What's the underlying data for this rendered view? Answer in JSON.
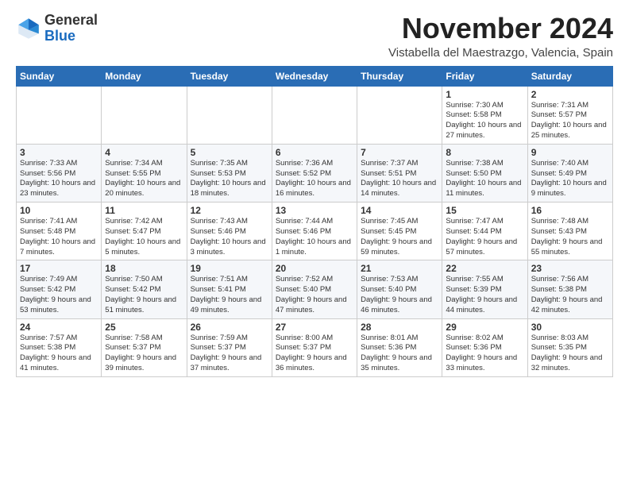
{
  "header": {
    "logo_general": "General",
    "logo_blue": "Blue",
    "month_title": "November 2024",
    "location": "Vistabella del Maestrazgo, Valencia, Spain"
  },
  "weekdays": [
    "Sunday",
    "Monday",
    "Tuesday",
    "Wednesday",
    "Thursday",
    "Friday",
    "Saturday"
  ],
  "weeks": [
    [
      {
        "day": "",
        "info": ""
      },
      {
        "day": "",
        "info": ""
      },
      {
        "day": "",
        "info": ""
      },
      {
        "day": "",
        "info": ""
      },
      {
        "day": "",
        "info": ""
      },
      {
        "day": "1",
        "info": "Sunrise: 7:30 AM\nSunset: 5:58 PM\nDaylight: 10 hours and 27 minutes."
      },
      {
        "day": "2",
        "info": "Sunrise: 7:31 AM\nSunset: 5:57 PM\nDaylight: 10 hours and 25 minutes."
      }
    ],
    [
      {
        "day": "3",
        "info": "Sunrise: 7:33 AM\nSunset: 5:56 PM\nDaylight: 10 hours and 23 minutes."
      },
      {
        "day": "4",
        "info": "Sunrise: 7:34 AM\nSunset: 5:55 PM\nDaylight: 10 hours and 20 minutes."
      },
      {
        "day": "5",
        "info": "Sunrise: 7:35 AM\nSunset: 5:53 PM\nDaylight: 10 hours and 18 minutes."
      },
      {
        "day": "6",
        "info": "Sunrise: 7:36 AM\nSunset: 5:52 PM\nDaylight: 10 hours and 16 minutes."
      },
      {
        "day": "7",
        "info": "Sunrise: 7:37 AM\nSunset: 5:51 PM\nDaylight: 10 hours and 14 minutes."
      },
      {
        "day": "8",
        "info": "Sunrise: 7:38 AM\nSunset: 5:50 PM\nDaylight: 10 hours and 11 minutes."
      },
      {
        "day": "9",
        "info": "Sunrise: 7:40 AM\nSunset: 5:49 PM\nDaylight: 10 hours and 9 minutes."
      }
    ],
    [
      {
        "day": "10",
        "info": "Sunrise: 7:41 AM\nSunset: 5:48 PM\nDaylight: 10 hours and 7 minutes."
      },
      {
        "day": "11",
        "info": "Sunrise: 7:42 AM\nSunset: 5:47 PM\nDaylight: 10 hours and 5 minutes."
      },
      {
        "day": "12",
        "info": "Sunrise: 7:43 AM\nSunset: 5:46 PM\nDaylight: 10 hours and 3 minutes."
      },
      {
        "day": "13",
        "info": "Sunrise: 7:44 AM\nSunset: 5:46 PM\nDaylight: 10 hours and 1 minute."
      },
      {
        "day": "14",
        "info": "Sunrise: 7:45 AM\nSunset: 5:45 PM\nDaylight: 9 hours and 59 minutes."
      },
      {
        "day": "15",
        "info": "Sunrise: 7:47 AM\nSunset: 5:44 PM\nDaylight: 9 hours and 57 minutes."
      },
      {
        "day": "16",
        "info": "Sunrise: 7:48 AM\nSunset: 5:43 PM\nDaylight: 9 hours and 55 minutes."
      }
    ],
    [
      {
        "day": "17",
        "info": "Sunrise: 7:49 AM\nSunset: 5:42 PM\nDaylight: 9 hours and 53 minutes."
      },
      {
        "day": "18",
        "info": "Sunrise: 7:50 AM\nSunset: 5:42 PM\nDaylight: 9 hours and 51 minutes."
      },
      {
        "day": "19",
        "info": "Sunrise: 7:51 AM\nSunset: 5:41 PM\nDaylight: 9 hours and 49 minutes."
      },
      {
        "day": "20",
        "info": "Sunrise: 7:52 AM\nSunset: 5:40 PM\nDaylight: 9 hours and 47 minutes."
      },
      {
        "day": "21",
        "info": "Sunrise: 7:53 AM\nSunset: 5:40 PM\nDaylight: 9 hours and 46 minutes."
      },
      {
        "day": "22",
        "info": "Sunrise: 7:55 AM\nSunset: 5:39 PM\nDaylight: 9 hours and 44 minutes."
      },
      {
        "day": "23",
        "info": "Sunrise: 7:56 AM\nSunset: 5:38 PM\nDaylight: 9 hours and 42 minutes."
      }
    ],
    [
      {
        "day": "24",
        "info": "Sunrise: 7:57 AM\nSunset: 5:38 PM\nDaylight: 9 hours and 41 minutes."
      },
      {
        "day": "25",
        "info": "Sunrise: 7:58 AM\nSunset: 5:37 PM\nDaylight: 9 hours and 39 minutes."
      },
      {
        "day": "26",
        "info": "Sunrise: 7:59 AM\nSunset: 5:37 PM\nDaylight: 9 hours and 37 minutes."
      },
      {
        "day": "27",
        "info": "Sunrise: 8:00 AM\nSunset: 5:37 PM\nDaylight: 9 hours and 36 minutes."
      },
      {
        "day": "28",
        "info": "Sunrise: 8:01 AM\nSunset: 5:36 PM\nDaylight: 9 hours and 35 minutes."
      },
      {
        "day": "29",
        "info": "Sunrise: 8:02 AM\nSunset: 5:36 PM\nDaylight: 9 hours and 33 minutes."
      },
      {
        "day": "30",
        "info": "Sunrise: 8:03 AM\nSunset: 5:35 PM\nDaylight: 9 hours and 32 minutes."
      }
    ]
  ]
}
